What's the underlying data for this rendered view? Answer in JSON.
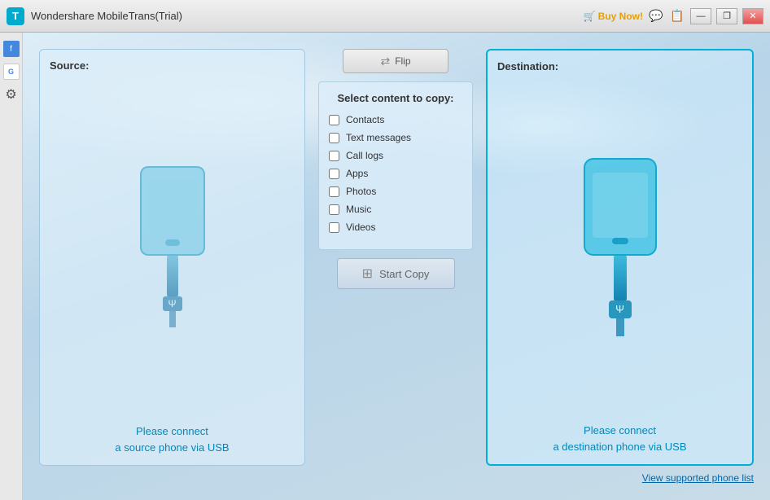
{
  "titleBar": {
    "icon": "T",
    "title": "Wondershare MobileTrans(Trial)",
    "buyNow": "Buy Now!",
    "minimize": "—",
    "restore": "❐",
    "close": "✕"
  },
  "source": {
    "label": "Source:",
    "connectText": "Please connect\na source phone via USB"
  },
  "destination": {
    "label": "Destination:",
    "connectText": "Please connect\na destination phone via USB"
  },
  "flipButton": {
    "label": "Flip"
  },
  "contentSelect": {
    "title": "Select content to copy:",
    "items": [
      {
        "id": "contacts",
        "label": "Contacts",
        "checked": false
      },
      {
        "id": "textmessages",
        "label": "Text messages",
        "checked": false
      },
      {
        "id": "calllogs",
        "label": "Call logs",
        "checked": false
      },
      {
        "id": "apps",
        "label": "Apps",
        "checked": false
      },
      {
        "id": "photos",
        "label": "Photos",
        "checked": false
      },
      {
        "id": "music",
        "label": "Music",
        "checked": false
      },
      {
        "id": "videos",
        "label": "Videos",
        "checked": false
      }
    ]
  },
  "startCopy": {
    "label": "Start Copy"
  },
  "footer": {
    "viewSupportedLink": "View supported phone list"
  },
  "icons": {
    "flip": "⇄",
    "startCopy": "⊞",
    "usb": "Ψ",
    "cart": "🛒",
    "chat": "💬",
    "docs": "📋"
  }
}
